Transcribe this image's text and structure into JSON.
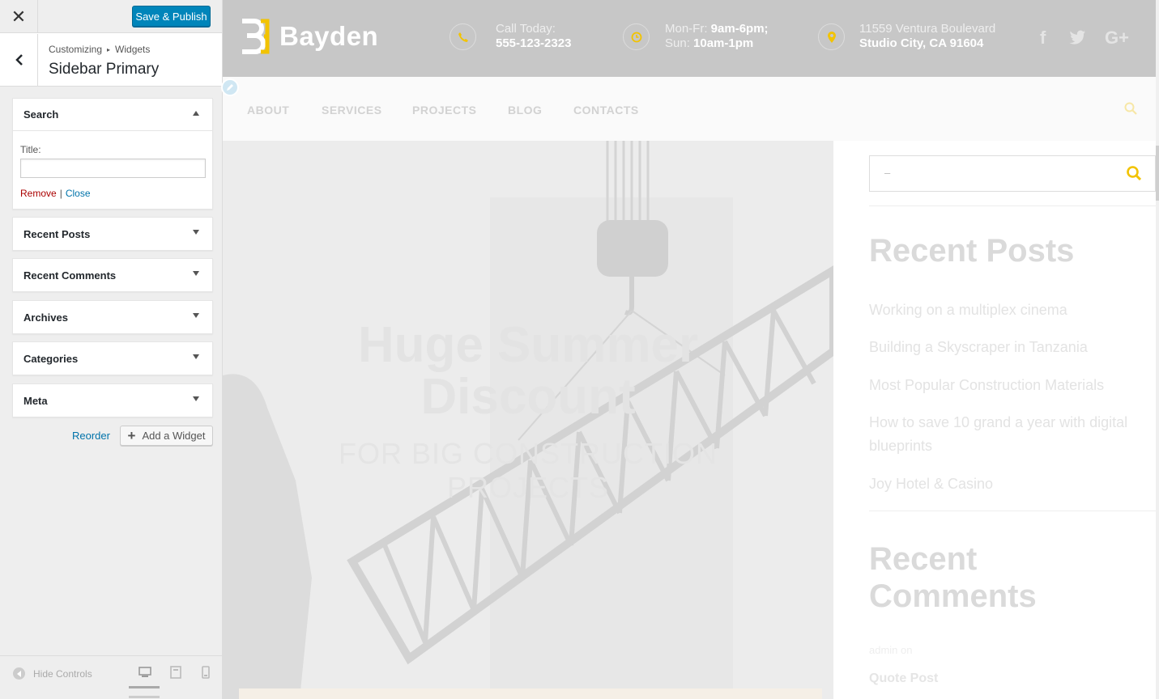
{
  "panel": {
    "close_label": "✕",
    "save_label": "Save & Publish",
    "breadcrumb": {
      "first": "Customizing",
      "separator": "▸",
      "second": "Widgets"
    },
    "section_title": "Sidebar Primary",
    "widgets": [
      {
        "title": "Search",
        "expanded": true
      },
      {
        "title": "Recent Posts",
        "expanded": false
      },
      {
        "title": "Recent Comments",
        "expanded": false
      },
      {
        "title": "Archives",
        "expanded": false
      },
      {
        "title": "Categories",
        "expanded": false
      },
      {
        "title": "Meta",
        "expanded": false
      }
    ],
    "search_widget": {
      "title_label": "Title:",
      "title_value": "",
      "remove_label": "Remove",
      "separator": "|",
      "close_label": "Close"
    },
    "reorder_label": "Reorder",
    "add_widget_label": "Add a Widget",
    "hide_controls_label": "Hide Controls"
  },
  "preview": {
    "brand": "Bayden",
    "contact": {
      "call_label": "Call Today:",
      "call_number": "555-123-2323",
      "hours_line1_label": "Mon-Fr:",
      "hours_line1_value": "9am-6pm;",
      "hours_line2_label": "Sun:",
      "hours_line2_value": "10am-1pm",
      "address_line1": "11559 Ventura Boulevard",
      "address_line2": "Studio City, CA 91604"
    },
    "social": [
      "f",
      "twitter",
      "G+"
    ],
    "nav": [
      "ABOUT",
      "SERVICES",
      "PROJECTS",
      "BLOG",
      "CONTACTS"
    ],
    "hero_title": "Huge Summer Discount",
    "hero_subtitle": "FOR BIG CONSTRUCTION PROJECTS",
    "sidebar": {
      "search_placeholder": "–",
      "recent_posts_title": "Recent Posts",
      "recent_posts": [
        "Working on a multiplex cinema",
        "Building a Skyscraper in Tanzania",
        "Most Popular Construction Materials",
        "How to save 10 grand a year with digital blueprints",
        "Joy Hotel & Casino"
      ],
      "recent_comments_title": "Recent Comments",
      "comment_meta": "admin on",
      "comment_post": "Quote Post"
    },
    "colors": {
      "accent": "#f2c300",
      "topbar": "#c7c7c7",
      "wp_blue": "#0085ba"
    }
  }
}
